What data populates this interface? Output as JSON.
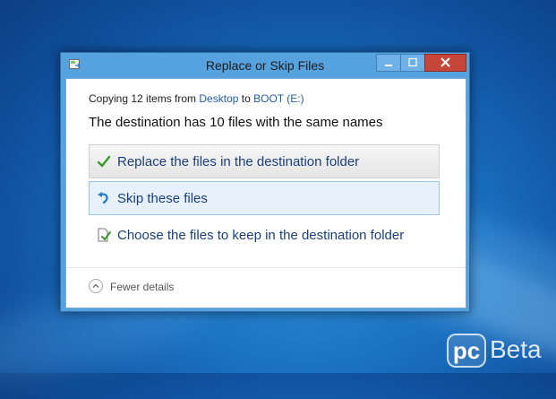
{
  "window": {
    "title": "Replace or Skip Files"
  },
  "dialog": {
    "copy_prefix": "Copying 12 items from",
    "source": "Desktop",
    "to_word": "to",
    "destination": "BOOT (E:)",
    "heading": "The destination has 10 files with the same names",
    "options": [
      {
        "label": "Replace the files in the destination folder",
        "icon": "checkmark-icon"
      },
      {
        "label": "Skip these files",
        "icon": "skip-arrow-icon"
      },
      {
        "label": "Choose the files to keep in the destination folder",
        "icon": "choose-files-icon"
      }
    ],
    "details_label": "Fewer details"
  },
  "watermark": {
    "pc": "pc",
    "beta": "Beta"
  },
  "colors": {
    "accent": "#1a3f79",
    "link": "#1e5fa8",
    "close_button": "#c7463a",
    "frame": "#56a2de"
  }
}
